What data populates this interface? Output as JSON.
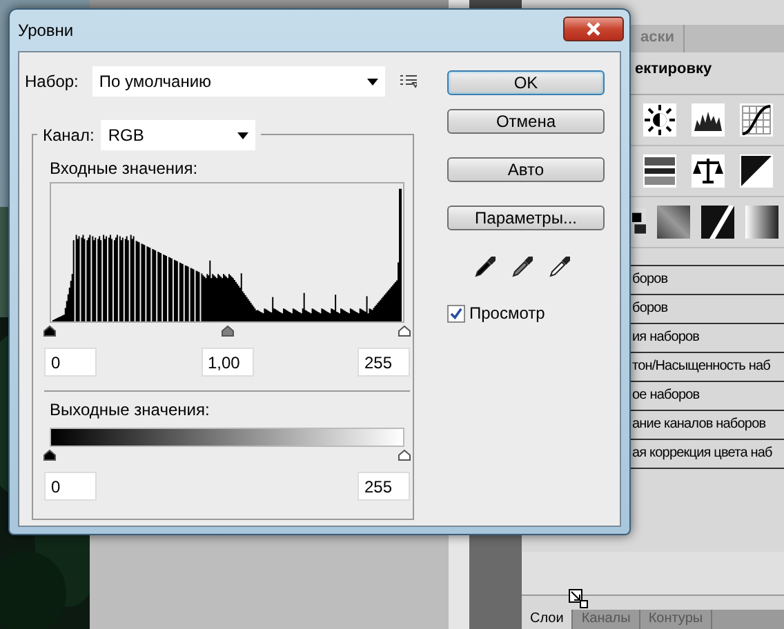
{
  "window": {
    "title": "Уровни"
  },
  "preset": {
    "label": "Набор:",
    "value": "По умолчанию"
  },
  "channel": {
    "label": "Канал:",
    "value": "RGB"
  },
  "input": {
    "label": "Входные значения:",
    "fields": [
      "0",
      "1,00",
      "255"
    ]
  },
  "output": {
    "label": "Выходные значения:",
    "fields": [
      "0",
      "255"
    ]
  },
  "buttons": [
    {
      "label": "OK",
      "default": true
    },
    {
      "label": "Отмена",
      "default": false
    },
    {
      "label": "Авто",
      "default": false
    },
    {
      "label": "Параметры...",
      "default": false
    }
  ],
  "eyedroppers": [
    {
      "kind": "black"
    },
    {
      "kind": "gray"
    },
    {
      "kind": "white"
    }
  ],
  "preview": {
    "label": "Просмотр",
    "checked": true
  },
  "panel": {
    "tab": "аски",
    "header": "ектировку",
    "items": [
      "боров",
      "боров",
      "ия наборов",
      "тон/Насыщенность наб",
      "ое наборов",
      "ание каналов наборов",
      "ая коррекция цвета наб"
    ],
    "bottom_tabs": [
      {
        "label": "Слои",
        "selected": true
      },
      {
        "label": "Каналы",
        "selected": false
      },
      {
        "label": "Контуры",
        "selected": false
      }
    ]
  }
}
